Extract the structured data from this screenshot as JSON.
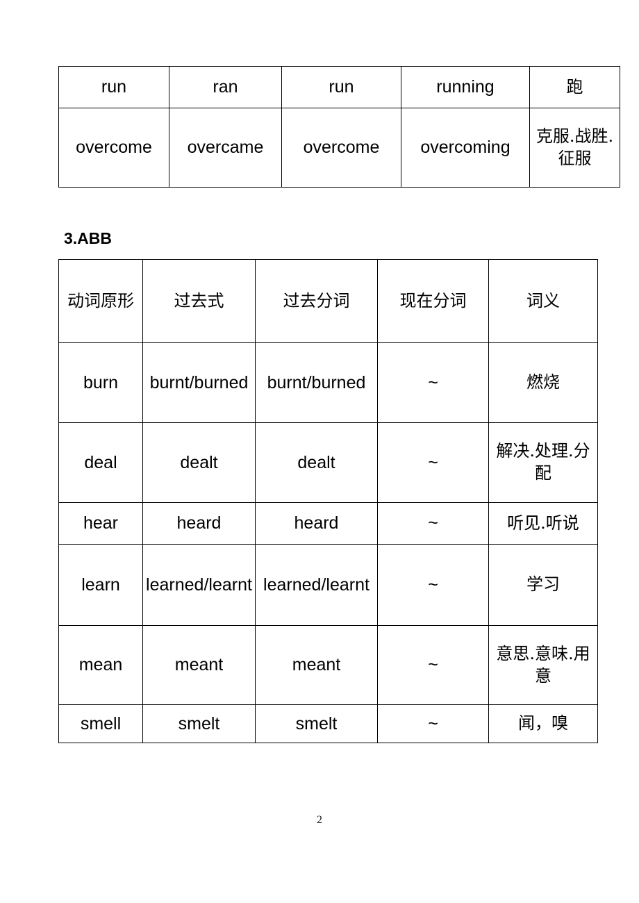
{
  "document": {
    "page_number": "2",
    "section_heading": "3.ABB"
  },
  "table_one": {
    "name": "verb-forms-continuation",
    "rows": [
      {
        "base": "run",
        "past": "ran",
        "past_participle": "run",
        "present_participle": "running",
        "meaning": "跑"
      },
      {
        "base": "overcome",
        "past": "overcame",
        "past_participle": "overcome",
        "present_participle": "overcoming",
        "meaning": "克服.战胜.征服"
      }
    ]
  },
  "table_two": {
    "name": "abb-verb-forms",
    "headers": {
      "base": "动词原形",
      "past": "过去式",
      "past_participle": "过去分词",
      "present_participle": "现在分词",
      "meaning": "词义"
    },
    "rows": [
      {
        "base": "burn",
        "past": "burnt/burned",
        "past_participle": "burnt/burned",
        "present_participle": "~",
        "meaning": "燃烧"
      },
      {
        "base": "deal",
        "past": "dealt",
        "past_participle": "dealt",
        "present_participle": "~",
        "meaning": "解决.处理.分配"
      },
      {
        "base": "hear",
        "past": "heard",
        "past_participle": "heard",
        "present_participle": "~",
        "meaning": "听见.听说"
      },
      {
        "base": "learn",
        "past": "learned/learnt",
        "past_participle": "learned/learnt",
        "present_participle": "~",
        "meaning": "学习"
      },
      {
        "base": "mean",
        "past": "meant",
        "past_participle": "meant",
        "present_participle": "~",
        "meaning": "意思.意味.用意"
      },
      {
        "base": "smell",
        "past": "smelt",
        "past_participle": "smelt",
        "present_participle": "~",
        "meaning": "闻，嗅"
      }
    ]
  }
}
